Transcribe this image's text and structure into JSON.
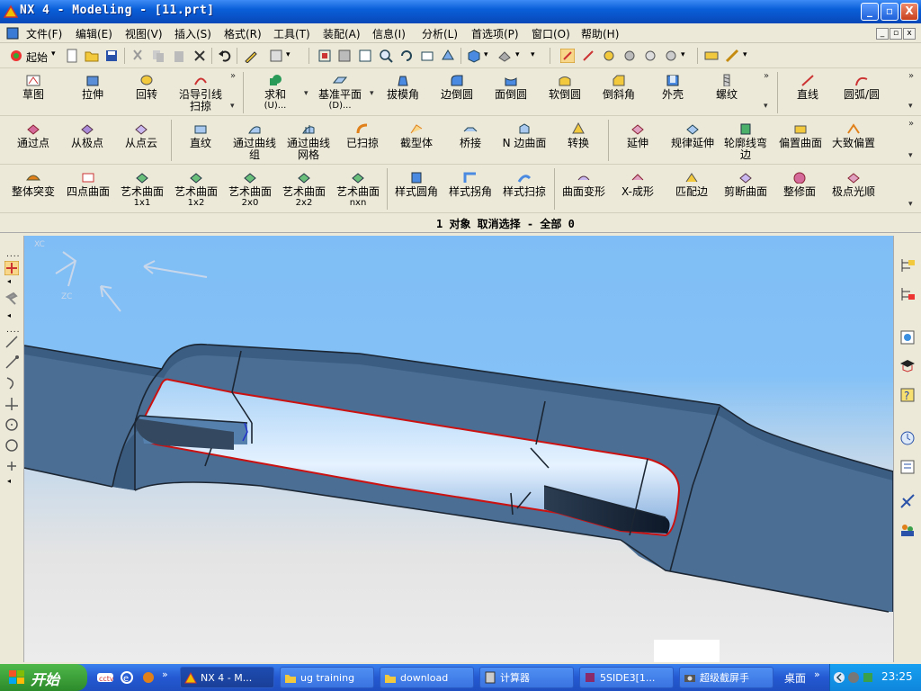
{
  "window": {
    "title": "NX 4 - Modeling - [11.prt]",
    "min": "_",
    "max": "▫",
    "close": "X"
  },
  "menubar": {
    "items": [
      "文件(F)",
      "编辑(E)",
      "视图(V)",
      "插入(S)",
      "格式(R)",
      "工具(T)",
      "装配(A)",
      "信息(I)",
      "分析(L)",
      "首选项(P)",
      "窗口(O)",
      "帮助(H)"
    ]
  },
  "toolbar_std": {
    "start_label": "起始"
  },
  "row_a": {
    "sketch": "草图",
    "extrude": "拉伸",
    "revolve": "回转",
    "sweep_line1": "沿导引线",
    "sweep_line2": "扫掠",
    "unite_line1": "求和",
    "unite_line2": "(U)...",
    "datum_line1": "基准平面",
    "datum_line2": "(D)...",
    "draft": "拔模角",
    "edge_blend": "边倒圆",
    "face_blend": "面倒圆",
    "soft_blend": "软倒圆",
    "chamfer": "倒斜角",
    "shell": "外壳",
    "thread": "螺纹",
    "line": "直线",
    "arc": "圆弧/圆"
  },
  "row_b": {
    "thru_points": "通过点",
    "from_poles": "从极点",
    "from_cloud": "从点云",
    "ruled": "直纹",
    "thru_curves_1": "通过曲线",
    "thru_curves_2": "组",
    "thru_mesh_1": "通过曲线",
    "thru_mesh_2": "网格",
    "swept": "已扫掠",
    "section": "截型体",
    "bridge": "桥接",
    "n_sided": "N 边曲面",
    "transform": "转换",
    "extension": "延伸",
    "law_ext": "规律延伸",
    "silhouette_1": "轮廓线弯",
    "silhouette_2": "边",
    "offset": "偏置曲面",
    "rough_offset": "大致偏置"
  },
  "row_c": {
    "bulge": "整体突变",
    "four_point": "四点曲面",
    "studio_label": "艺术曲面",
    "s1": "1x1",
    "s2": "1x2",
    "s3": "2x0",
    "s4": "2x2",
    "s5": "nxn",
    "styled_blend": "样式圆角",
    "styled_corner": "样式拐角",
    "styled_sweep": "样式扫掠",
    "face_deform": "曲面变形",
    "x_form": "X-成形",
    "match_edge": "匹配边",
    "trim_surface": "剪断曲面",
    "refit": "整修面",
    "pole_smooth": "极点光顺"
  },
  "status": {
    "text": "1 对象 取消选择 - 全部 0"
  },
  "triad": {
    "xc": "XC",
    "zc": "ZC"
  },
  "taskbar": {
    "start": "开始",
    "tasks": [
      "NX 4 - M...",
      "ug training",
      "download",
      "计算器",
      "5SIDE3[1...",
      "超级截屏手"
    ],
    "desktop": "桌面",
    "clock": "23:25"
  },
  "colors": {
    "part": "#4a6e94",
    "part_light": "#6b8db0",
    "cut_edge": "#cc1111",
    "title_blue": "#0a5fd8",
    "taskbar_blue": "#2459d2"
  }
}
